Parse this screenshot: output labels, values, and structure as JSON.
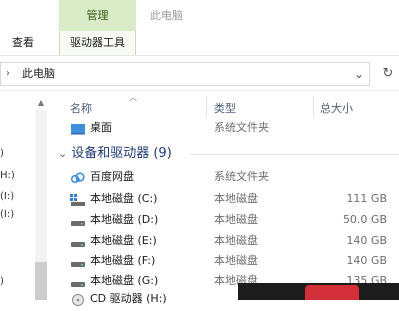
{
  "ribbon": {
    "context_tab_header": "管理",
    "window_title": "此电脑",
    "tabs": [
      "查看",
      "驱动器工具"
    ]
  },
  "address": {
    "path": "此电脑",
    "chevron": "›",
    "dropdown": "⌄",
    "refresh": "↻"
  },
  "nav_pane": {
    "fragments": [
      ")",
      "H:)",
      "(I:)",
      "(I:)",
      ")"
    ]
  },
  "columns": {
    "name": "名称",
    "type": "类型",
    "size": "总大小"
  },
  "folders": [
    {
      "name": "桌面",
      "type": "系统文件夹",
      "icon": "desktop-icon"
    }
  ],
  "group": {
    "title": "设备和驱动器 (9)",
    "chevron": "⌄"
  },
  "drives": [
    {
      "name": "百度网盘",
      "type": "系统文件夹",
      "size": "",
      "icon": "cloud-icon"
    },
    {
      "name": "本地磁盘 (C:)",
      "type": "本地磁盘",
      "size": "111 GB",
      "icon": "windows-drive-icon"
    },
    {
      "name": "本地磁盘 (D:)",
      "type": "本地磁盘",
      "size": "50.0 GB",
      "icon": "drive-icon"
    },
    {
      "name": "本地磁盘 (E:)",
      "type": "本地磁盘",
      "size": "140 GB",
      "icon": "drive-icon"
    },
    {
      "name": "本地磁盘 (F:)",
      "type": "本地磁盘",
      "size": "140 GB",
      "icon": "drive-icon"
    },
    {
      "name": "本地磁盘 (G:)",
      "type": "本地磁盘",
      "size": "135 GB",
      "icon": "drive-icon"
    },
    {
      "name": "CD 驱动器 (H:)",
      "type": "",
      "size": "",
      "icon": "cd-drive-icon"
    }
  ],
  "colors": {
    "context_tab_green": "#d9ecc7",
    "group_header_blue": "#1e3a78",
    "column_header_text": "#4c607a"
  }
}
